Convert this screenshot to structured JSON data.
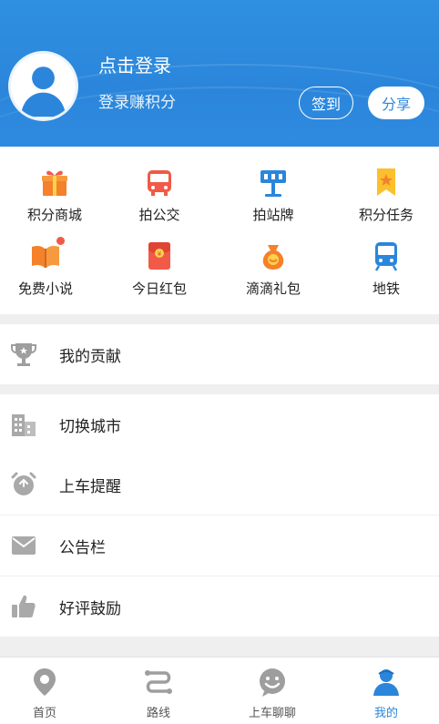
{
  "header": {
    "login_title": "点击登录",
    "login_sub": "登录赚积分",
    "sign_in": "签到",
    "share": "分享"
  },
  "grid": [
    {
      "label": "积分商城",
      "icon": "gift-icon"
    },
    {
      "label": "拍公交",
      "icon": "bus-icon"
    },
    {
      "label": "拍站牌",
      "icon": "stop-sign-icon"
    },
    {
      "label": "积分任务",
      "icon": "bookmark-star-icon"
    },
    {
      "label": "免费小说",
      "icon": "book-icon"
    },
    {
      "label": "今日红包",
      "icon": "red-envelope-icon"
    },
    {
      "label": "滴滴礼包",
      "icon": "money-bag-icon"
    },
    {
      "label": "地铁",
      "icon": "metro-icon"
    }
  ],
  "menu": {
    "contribution": "我的贡献",
    "switch_city": "切换城市",
    "alert": "上车提醒",
    "notice": "公告栏",
    "praise": "好评鼓励"
  },
  "tabs": [
    {
      "label": "首页",
      "icon": "location-pin-icon"
    },
    {
      "label": "路线",
      "icon": "route-icon"
    },
    {
      "label": "上车聊聊",
      "icon": "chat-face-icon"
    },
    {
      "label": "我的",
      "icon": "profile-icon"
    }
  ],
  "colors": {
    "primary": "#2b86db",
    "orange": "#f5812a",
    "red": "#f05a47",
    "gray_icon": "#a9a9a9"
  }
}
